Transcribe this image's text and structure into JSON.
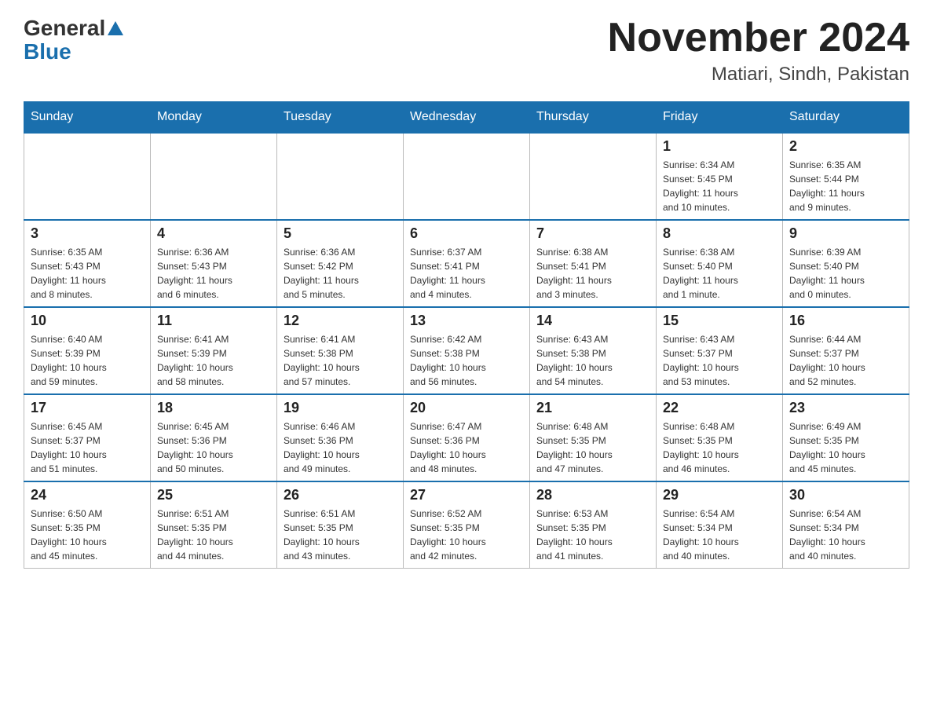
{
  "header": {
    "logo_general": "General",
    "logo_blue": "Blue",
    "month_title": "November 2024",
    "location": "Matiari, Sindh, Pakistan"
  },
  "days_of_week": [
    "Sunday",
    "Monday",
    "Tuesday",
    "Wednesday",
    "Thursday",
    "Friday",
    "Saturday"
  ],
  "weeks": [
    {
      "cells": [
        {
          "day": "",
          "info": ""
        },
        {
          "day": "",
          "info": ""
        },
        {
          "day": "",
          "info": ""
        },
        {
          "day": "",
          "info": ""
        },
        {
          "day": "",
          "info": ""
        },
        {
          "day": "1",
          "info": "Sunrise: 6:34 AM\nSunset: 5:45 PM\nDaylight: 11 hours\nand 10 minutes."
        },
        {
          "day": "2",
          "info": "Sunrise: 6:35 AM\nSunset: 5:44 PM\nDaylight: 11 hours\nand 9 minutes."
        }
      ]
    },
    {
      "cells": [
        {
          "day": "3",
          "info": "Sunrise: 6:35 AM\nSunset: 5:43 PM\nDaylight: 11 hours\nand 8 minutes."
        },
        {
          "day": "4",
          "info": "Sunrise: 6:36 AM\nSunset: 5:43 PM\nDaylight: 11 hours\nand 6 minutes."
        },
        {
          "day": "5",
          "info": "Sunrise: 6:36 AM\nSunset: 5:42 PM\nDaylight: 11 hours\nand 5 minutes."
        },
        {
          "day": "6",
          "info": "Sunrise: 6:37 AM\nSunset: 5:41 PM\nDaylight: 11 hours\nand 4 minutes."
        },
        {
          "day": "7",
          "info": "Sunrise: 6:38 AM\nSunset: 5:41 PM\nDaylight: 11 hours\nand 3 minutes."
        },
        {
          "day": "8",
          "info": "Sunrise: 6:38 AM\nSunset: 5:40 PM\nDaylight: 11 hours\nand 1 minute."
        },
        {
          "day": "9",
          "info": "Sunrise: 6:39 AM\nSunset: 5:40 PM\nDaylight: 11 hours\nand 0 minutes."
        }
      ]
    },
    {
      "cells": [
        {
          "day": "10",
          "info": "Sunrise: 6:40 AM\nSunset: 5:39 PM\nDaylight: 10 hours\nand 59 minutes."
        },
        {
          "day": "11",
          "info": "Sunrise: 6:41 AM\nSunset: 5:39 PM\nDaylight: 10 hours\nand 58 minutes."
        },
        {
          "day": "12",
          "info": "Sunrise: 6:41 AM\nSunset: 5:38 PM\nDaylight: 10 hours\nand 57 minutes."
        },
        {
          "day": "13",
          "info": "Sunrise: 6:42 AM\nSunset: 5:38 PM\nDaylight: 10 hours\nand 56 minutes."
        },
        {
          "day": "14",
          "info": "Sunrise: 6:43 AM\nSunset: 5:38 PM\nDaylight: 10 hours\nand 54 minutes."
        },
        {
          "day": "15",
          "info": "Sunrise: 6:43 AM\nSunset: 5:37 PM\nDaylight: 10 hours\nand 53 minutes."
        },
        {
          "day": "16",
          "info": "Sunrise: 6:44 AM\nSunset: 5:37 PM\nDaylight: 10 hours\nand 52 minutes."
        }
      ]
    },
    {
      "cells": [
        {
          "day": "17",
          "info": "Sunrise: 6:45 AM\nSunset: 5:37 PM\nDaylight: 10 hours\nand 51 minutes."
        },
        {
          "day": "18",
          "info": "Sunrise: 6:45 AM\nSunset: 5:36 PM\nDaylight: 10 hours\nand 50 minutes."
        },
        {
          "day": "19",
          "info": "Sunrise: 6:46 AM\nSunset: 5:36 PM\nDaylight: 10 hours\nand 49 minutes."
        },
        {
          "day": "20",
          "info": "Sunrise: 6:47 AM\nSunset: 5:36 PM\nDaylight: 10 hours\nand 48 minutes."
        },
        {
          "day": "21",
          "info": "Sunrise: 6:48 AM\nSunset: 5:35 PM\nDaylight: 10 hours\nand 47 minutes."
        },
        {
          "day": "22",
          "info": "Sunrise: 6:48 AM\nSunset: 5:35 PM\nDaylight: 10 hours\nand 46 minutes."
        },
        {
          "day": "23",
          "info": "Sunrise: 6:49 AM\nSunset: 5:35 PM\nDaylight: 10 hours\nand 45 minutes."
        }
      ]
    },
    {
      "cells": [
        {
          "day": "24",
          "info": "Sunrise: 6:50 AM\nSunset: 5:35 PM\nDaylight: 10 hours\nand 45 minutes."
        },
        {
          "day": "25",
          "info": "Sunrise: 6:51 AM\nSunset: 5:35 PM\nDaylight: 10 hours\nand 44 minutes."
        },
        {
          "day": "26",
          "info": "Sunrise: 6:51 AM\nSunset: 5:35 PM\nDaylight: 10 hours\nand 43 minutes."
        },
        {
          "day": "27",
          "info": "Sunrise: 6:52 AM\nSunset: 5:35 PM\nDaylight: 10 hours\nand 42 minutes."
        },
        {
          "day": "28",
          "info": "Sunrise: 6:53 AM\nSunset: 5:35 PM\nDaylight: 10 hours\nand 41 minutes."
        },
        {
          "day": "29",
          "info": "Sunrise: 6:54 AM\nSunset: 5:34 PM\nDaylight: 10 hours\nand 40 minutes."
        },
        {
          "day": "30",
          "info": "Sunrise: 6:54 AM\nSunset: 5:34 PM\nDaylight: 10 hours\nand 40 minutes."
        }
      ]
    }
  ]
}
